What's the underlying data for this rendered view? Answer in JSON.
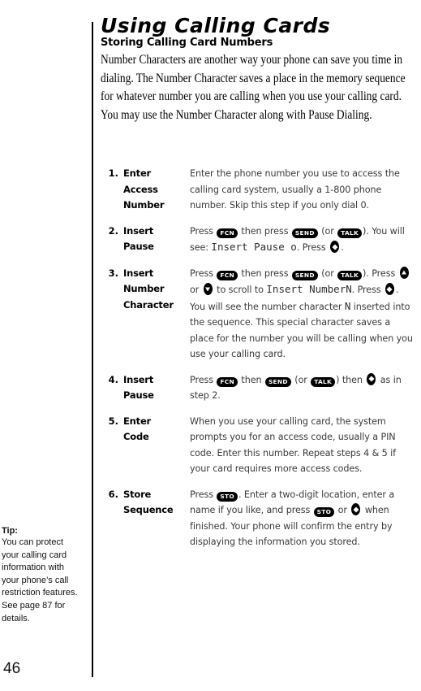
{
  "page": {
    "title": "Using Calling Cards",
    "folio": "46"
  },
  "section": {
    "heading": "Storing Calling Card Numbers",
    "intro": "Number Characters are another way your phone can save you time in dialing. The Number Character saves a place in the memory sequence for whatever number you are calling when you use your calling card. You may use the Number Character along with Pause Dialing."
  },
  "keys": {
    "fcn": "FCN",
    "send": "SEND",
    "talk": "TALK",
    "sto": "STO"
  },
  "display": {
    "insert_pause": "Insert Pause o",
    "insert_number": "Insert Number",
    "number_character": "N"
  },
  "steps": [
    {
      "number": "1.",
      "label_lines": [
        "Enter",
        "Access",
        "Number"
      ],
      "text": "Enter the phone number you use to access the calling card system, usually a 1-800 phone number. Skip this step if you only dial 0."
    },
    {
      "number": "2.",
      "label_lines": [
        "Insert",
        "Pause"
      ],
      "text_parts": {
        "a": "Press ",
        "b": " then press ",
        "c": " (or ",
        "d": "). You will see: ",
        "e": ". Press ",
        "f": "."
      }
    },
    {
      "number": "3.",
      "label_lines": [
        "Insert",
        "Number",
        "Character"
      ],
      "text_parts": {
        "a": "Press ",
        "b": " then press ",
        "c": " (or ",
        "d": "). Press ",
        "e": " or ",
        "f": " to scroll to ",
        "g": ". Press ",
        "h": ". You will see the number character ",
        "i": " inserted into the sequence. This special character saves a place for the number you will be calling when you use your calling card."
      }
    },
    {
      "number": "4.",
      "label_lines": [
        "Insert",
        "Pause"
      ],
      "text_parts": {
        "a": "Press ",
        "b": " then ",
        "c": " (or ",
        "d": ") then ",
        "e": " as in step 2."
      }
    },
    {
      "number": "5.",
      "label_lines": [
        "Enter",
        "Code"
      ],
      "text": "When you use your calling card, the system prompts you for an access code, usually a PIN code. Enter this number. Repeat steps 4 & 5 if your card requires more access codes."
    },
    {
      "number": "6.",
      "label_lines": [
        "Store",
        "Sequence"
      ],
      "text_parts": {
        "a": "Press ",
        "b": ". Enter a two-digit location, enter a name if you like, and press ",
        "c": " or ",
        "d": " when finished. Your phone will confirm the entry by displaying the information you stored."
      }
    }
  ],
  "tip": {
    "heading": "Tip:",
    "body": "You can protect your calling card information with your phone’s call restriction features. See page 87 for details."
  },
  "colors": {
    "text": "#000000",
    "body_text": "#3a3a3a",
    "key_bg": "#000000",
    "key_fg": "#ffffff"
  }
}
